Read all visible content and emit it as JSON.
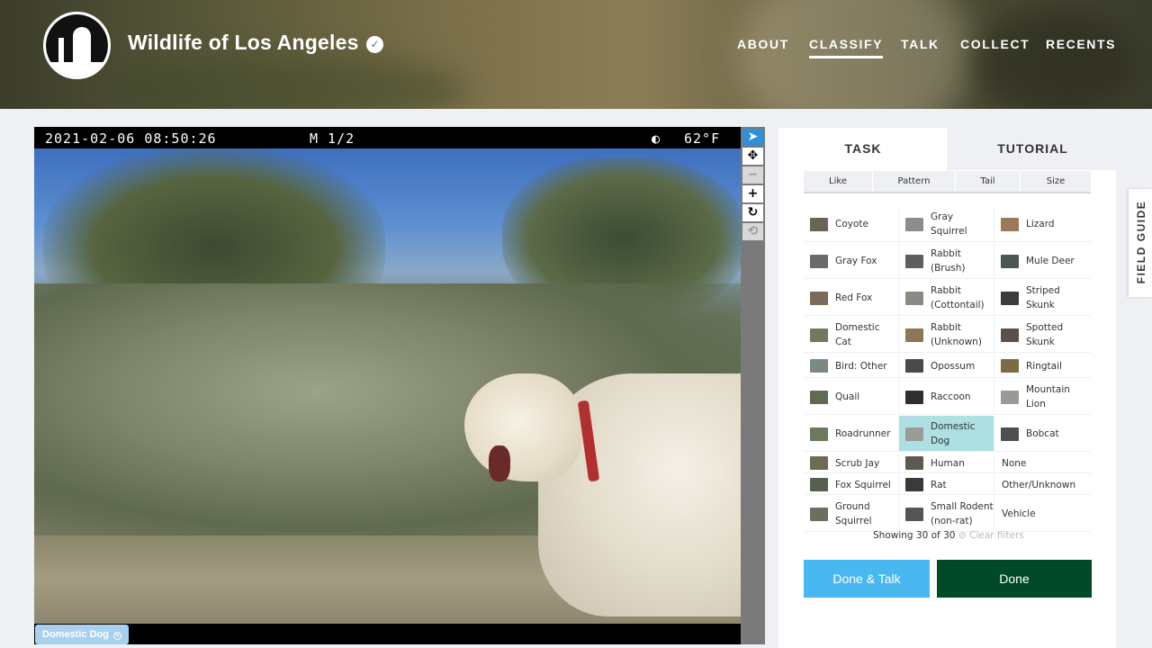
{
  "header": {
    "site_title": "Wildlife of Los Angeles",
    "nav": [
      "ABOUT",
      "CLASSIFY",
      "TALK",
      "COLLECT",
      "RECENTS"
    ],
    "active_nav": "CLASSIFY"
  },
  "viewer": {
    "timestamp": "2021-02-06 08:50:26",
    "frame": "M 1/2",
    "moon_symbol": "◐",
    "temperature": "62°F",
    "annotation_tag": "Domestic Dog",
    "tools": [
      "pointer-icon",
      "pan-icon",
      "zoom-out-icon",
      "zoom-in-icon",
      "rotate-icon",
      "reset-icon"
    ]
  },
  "panel": {
    "tabs": [
      "TASK",
      "TUTORIAL"
    ],
    "active_tab": "TASK",
    "filters": [
      "Like",
      "Pattern",
      "Tail",
      "Size"
    ],
    "choices": [
      {
        "label": "Coyote",
        "thumb": "#6b6455"
      },
      {
        "label": "Gray\nSquirrel",
        "thumb": "#8a8d88"
      },
      {
        "label": "Lizard",
        "thumb": "#9b7a5a"
      },
      {
        "label": "Gray Fox",
        "thumb": "#6a6a6a"
      },
      {
        "label": "Rabbit\n(Brush)",
        "thumb": "#5f5f5f"
      },
      {
        "label": "Mule Deer",
        "thumb": "#4e5652"
      },
      {
        "label": "Red Fox",
        "thumb": "#7c6a5a"
      },
      {
        "label": "Rabbit\n(Cottontail)",
        "thumb": "#8b8b85"
      },
      {
        "label": "Striped\nSkunk",
        "thumb": "#3c3c3c"
      },
      {
        "label": "Domestic\nCat",
        "thumb": "#6f7a5e"
      },
      {
        "label": "Rabbit\n(Unknown)",
        "thumb": "#8c7656"
      },
      {
        "label": "Spotted\nSkunk",
        "thumb": "#5a5048"
      },
      {
        "label": "Bird: Other",
        "thumb": "#7a8a7e"
      },
      {
        "label": "Opossum",
        "thumb": "#4a4a4a"
      },
      {
        "label": "Ringtail",
        "thumb": "#7d6b46"
      },
      {
        "label": "Quail",
        "thumb": "#5f6b52"
      },
      {
        "label": "Raccoon",
        "thumb": "#2f2f2f"
      },
      {
        "label": "Mountain\nLion",
        "thumb": "#9a9a94"
      },
      {
        "label": "Roadrunner",
        "thumb": "#6b7a5c"
      },
      {
        "label": "Domestic\nDog",
        "thumb": "#9a9a96"
      },
      {
        "label": "Bobcat",
        "thumb": "#4f4f4f"
      },
      {
        "label": "Scrub Jay",
        "thumb": "#6f6a52"
      },
      {
        "label": "Human",
        "thumb": "#5e5a50"
      },
      {
        "label": "None",
        "thumb": ""
      },
      {
        "label": "Fox Squirrel",
        "thumb": "#555f50"
      },
      {
        "label": "Rat",
        "thumb": "#3a3a3a"
      },
      {
        "label": "Other/Unknown",
        "thumb": ""
      },
      {
        "label": "Ground\nSquirrel",
        "thumb": "#6a7060"
      },
      {
        "label": "Small Rodent\n(non-rat)",
        "thumb": "#555555"
      },
      {
        "label": "Vehicle",
        "thumb": ""
      }
    ],
    "selected_choice": "Domestic\nDog",
    "showing_text": "Showing 30 of 30",
    "clear_filters": "⊘ Clear filters",
    "done_talk_label": "Done & Talk",
    "done_label": "Done"
  },
  "field_guide_label": "FIELD GUIDE"
}
